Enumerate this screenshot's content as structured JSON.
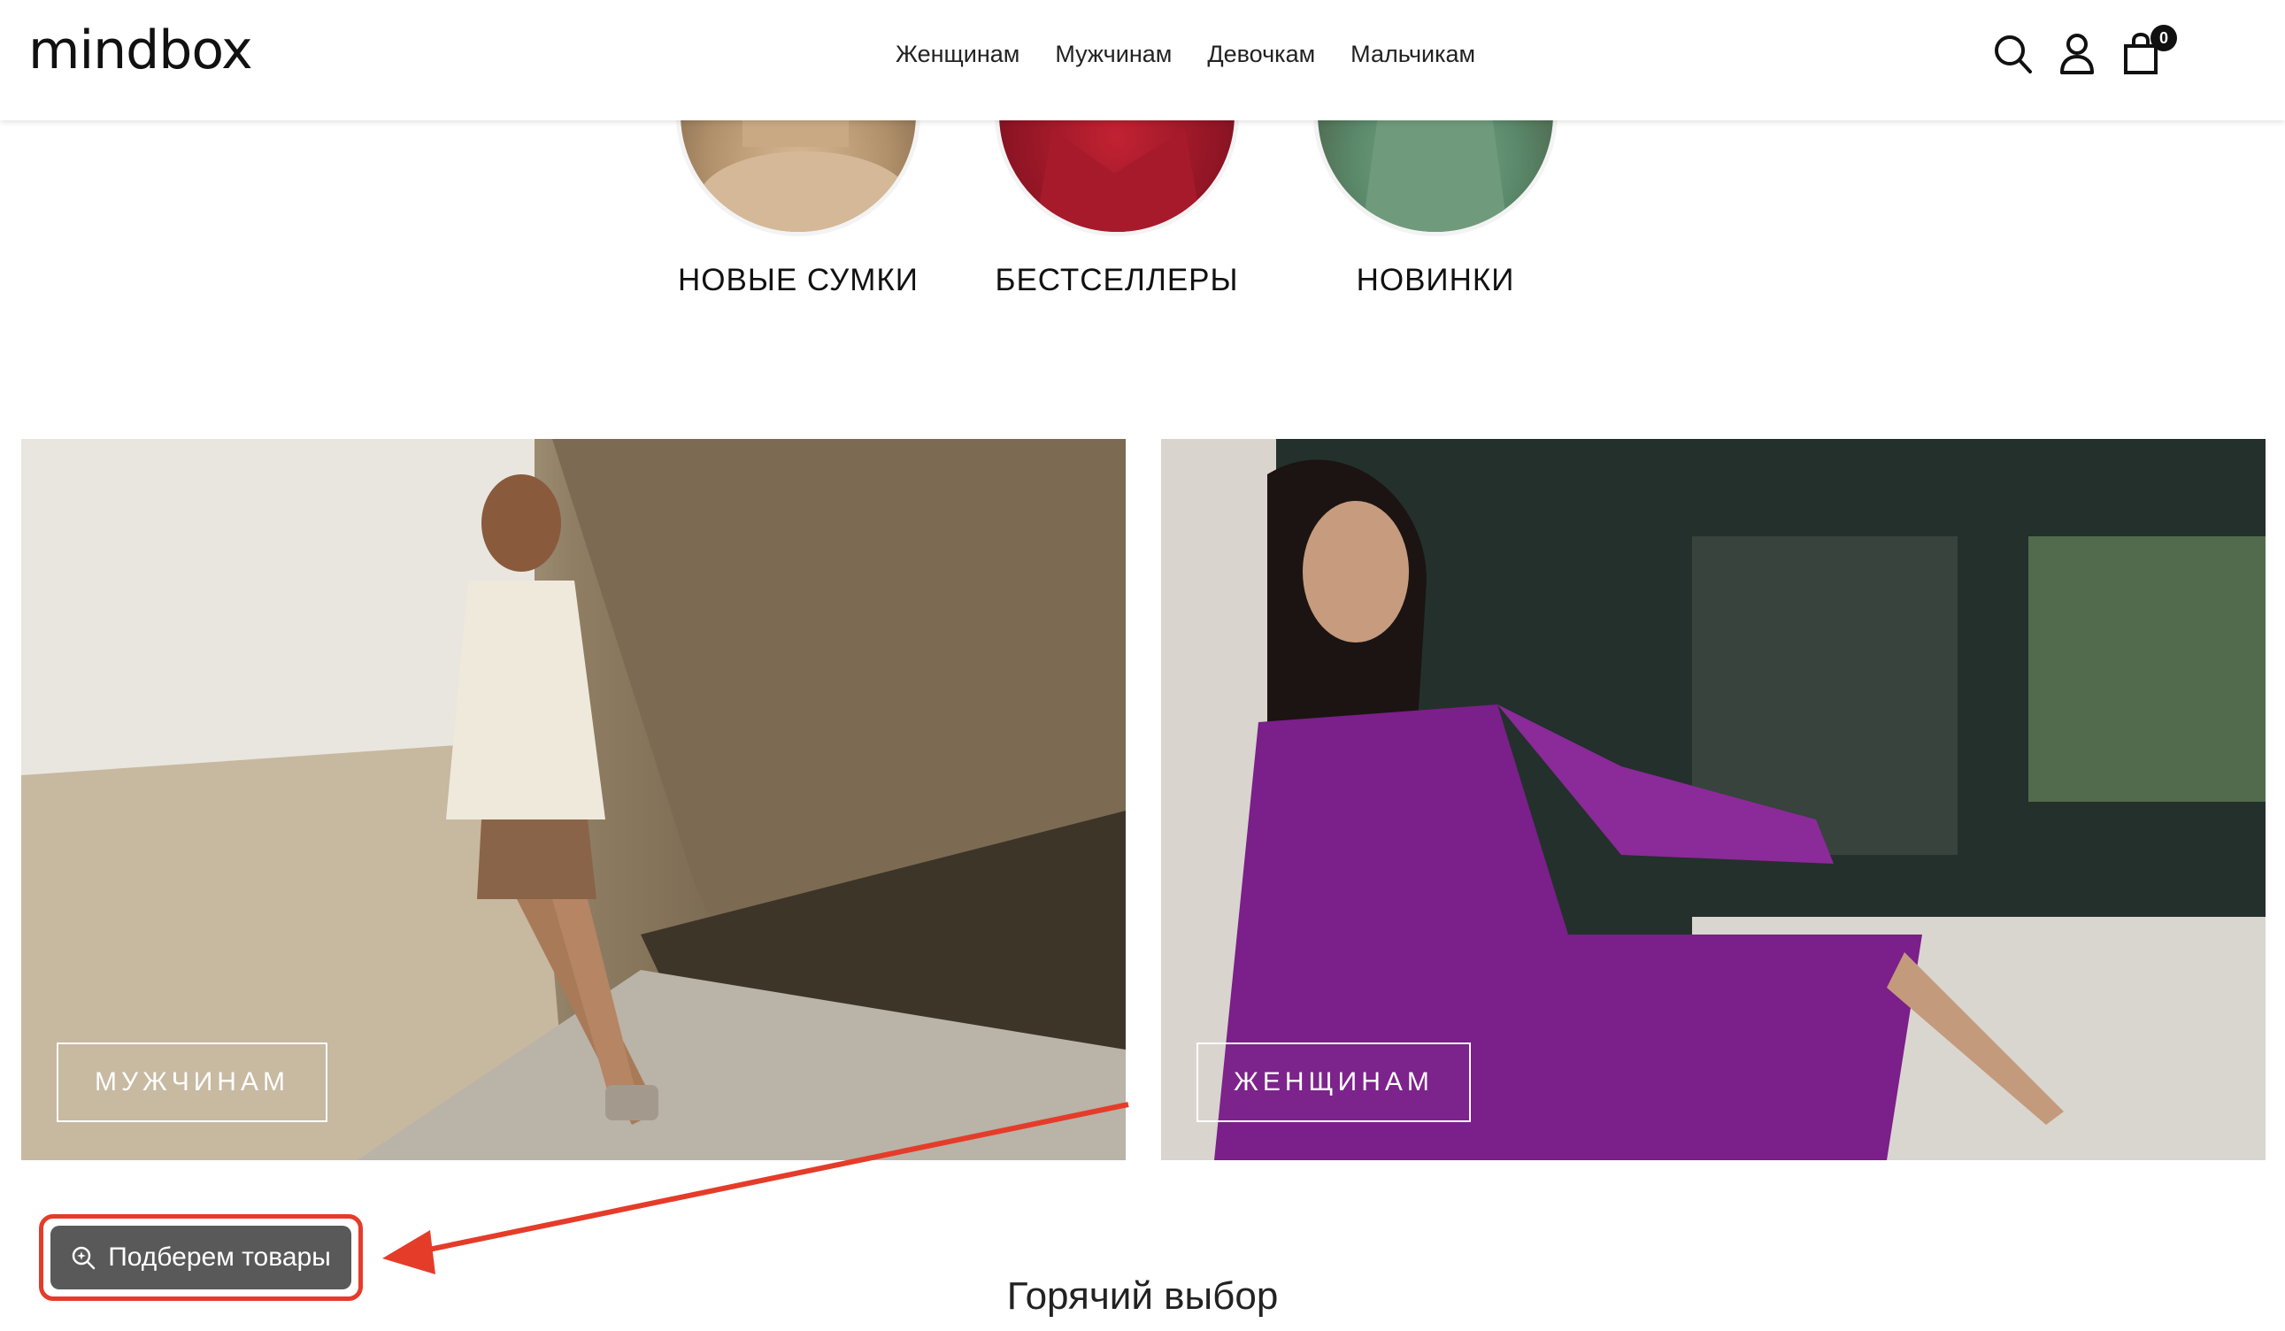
{
  "header": {
    "logo": "mindbox",
    "nav": [
      "Женщинам",
      "Мужчинам",
      "Девочкам",
      "Мальчикам"
    ],
    "cart_count": "0",
    "icons": [
      "search-icon",
      "user-icon",
      "cart-icon"
    ]
  },
  "categories": [
    "НОВЫЕ СУМКИ",
    "БЕСТСЕЛЛЕРЫ",
    "НОВИНКИ"
  ],
  "banners": {
    "men_label": "МУЖЧИНАМ",
    "women_label": "ЖЕНЩИНАМ"
  },
  "widget": {
    "label": "Подберем товары"
  },
  "section": {
    "title": "Горячий выбор"
  },
  "colors": {
    "accent_red": "#e53c2a",
    "widget_bg": "#595959",
    "dress_purple": "#7b1f8a"
  }
}
